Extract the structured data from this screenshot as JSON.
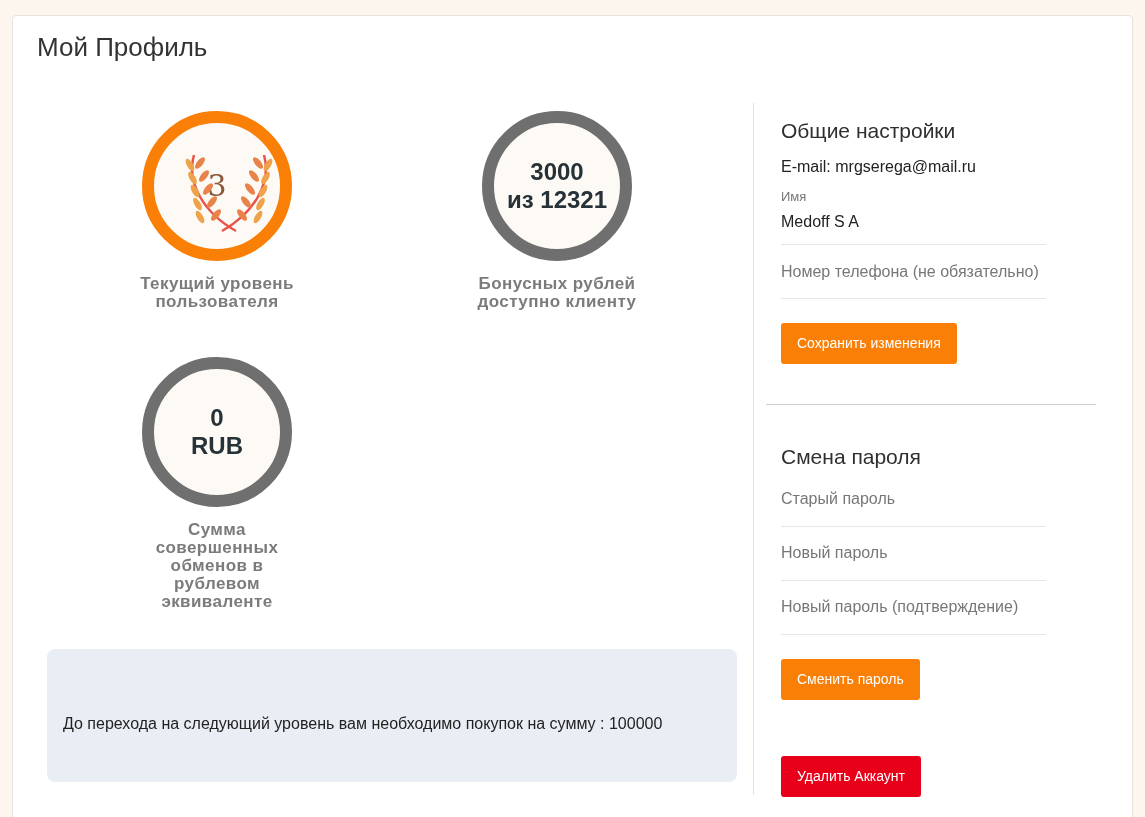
{
  "title": "Мой Профиль",
  "stats": [
    {
      "kind": "level",
      "value": "3",
      "caption": "Текущий уровень пользователя"
    },
    {
      "kind": "amount",
      "lines": [
        "3000",
        "из 12321"
      ],
      "caption": "Бонусных рублей доступно клиенту"
    },
    {
      "kind": "amount",
      "lines": [
        "0",
        "RUB"
      ],
      "caption": "Сумма совершенных обменов в рублевом эквиваленте"
    }
  ],
  "notice": "До перехода на следующий уровень вам необходимо покупок на сумму : 100000",
  "general": {
    "heading": "Общие настройки",
    "email": "E-mail: mrgserega@mail.ru",
    "fields": [
      {
        "label": "Имя",
        "value": "Medoff S A"
      },
      {
        "placeholder": "Номер телефона (не обязательно)"
      }
    ],
    "button": "Сохранить изменения"
  },
  "password": {
    "heading": "Смена пароля",
    "fields": [
      {
        "placeholder": "Старый пароль"
      },
      {
        "placeholder": "Новый пароль"
      },
      {
        "placeholder": "Новый пароль (подтверждение)"
      }
    ],
    "button": "Сменить пароль"
  },
  "delete_button": "Удалить Аккаунт"
}
